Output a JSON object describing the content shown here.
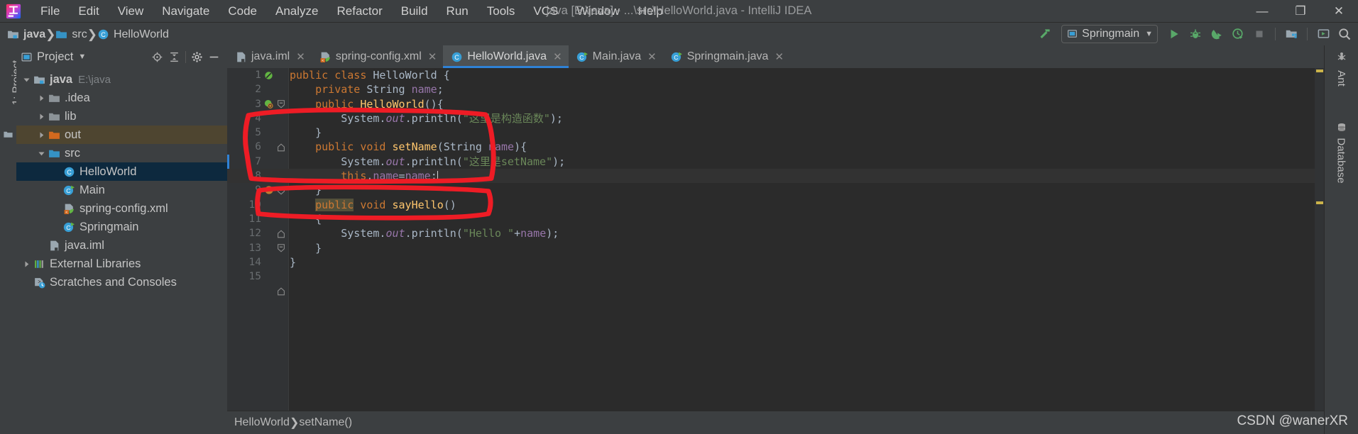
{
  "window": {
    "title": "java [E:\\java] - ...\\src\\HelloWorld.java - IntelliJ IDEA",
    "minimize": "—",
    "maximize": "❐",
    "close": "✕"
  },
  "menu": {
    "items": [
      {
        "label": "File",
        "mnemonic": "F"
      },
      {
        "label": "Edit",
        "mnemonic": "E"
      },
      {
        "label": "View",
        "mnemonic": "V"
      },
      {
        "label": "Navigate",
        "mnemonic": "N"
      },
      {
        "label": "Code",
        "mnemonic": "C"
      },
      {
        "label": "Analyze",
        "mnemonic": "z"
      },
      {
        "label": "Refactor",
        "mnemonic": "R"
      },
      {
        "label": "Build",
        "mnemonic": "B"
      },
      {
        "label": "Run",
        "mnemonic": "u"
      },
      {
        "label": "Tools",
        "mnemonic": "T"
      },
      {
        "label": "VCS",
        "mnemonic": "S"
      },
      {
        "label": "Window",
        "mnemonic": "W"
      },
      {
        "label": "Help",
        "mnemonic": "H"
      }
    ]
  },
  "navbar": {
    "crumbs": [
      {
        "label": "java",
        "icon": "module-folder-icon"
      },
      {
        "label": "src",
        "icon": "source-folder-icon"
      },
      {
        "label": "HelloWorld",
        "icon": "java-class-icon"
      }
    ],
    "separator": "❯"
  },
  "toolbar": {
    "build_label": "build-hammer-icon",
    "run_config": "Springmain",
    "run_config_caret": "▼",
    "buttons": [
      {
        "name": "run-button",
        "glyph": "▶"
      },
      {
        "name": "debug-button",
        "glyph": "debug-bug-icon"
      },
      {
        "name": "run-with-coverage-button",
        "glyph": "coverage-icon"
      },
      {
        "name": "profiler-button",
        "glyph": "profiler-icon"
      },
      {
        "name": "stop-button",
        "glyph": "■"
      },
      {
        "name": "project-structure-button",
        "glyph": "project-structure-icon"
      },
      {
        "name": "select-opened-file-button",
        "glyph": "terminal-icon"
      },
      {
        "name": "search-everywhere-button",
        "glyph": "search-icon"
      }
    ]
  },
  "left_strip": {
    "project_tool_label": "1: Project",
    "favorites_icon": "folder-icon"
  },
  "project_panel": {
    "title": "Project",
    "title_caret": "▼",
    "actions": [
      {
        "name": "scroll-from-source-icon"
      },
      {
        "name": "collapse-all-icon"
      },
      {
        "name": "settings-gear-icon"
      },
      {
        "name": "hide-panel-icon"
      }
    ],
    "tree": [
      {
        "label": "java",
        "suffix": "E:\\java",
        "depth": 0,
        "arrow": "down",
        "icon": "module-folder-icon",
        "bold": true,
        "state": "none"
      },
      {
        "label": ".idea",
        "suffix": "",
        "depth": 1,
        "arrow": "right",
        "icon": "folder-grey-icon",
        "bold": false,
        "state": "none"
      },
      {
        "label": "lib",
        "suffix": "",
        "depth": 1,
        "arrow": "right",
        "icon": "folder-grey-icon",
        "bold": false,
        "state": "none"
      },
      {
        "label": "out",
        "suffix": "",
        "depth": 1,
        "arrow": "right",
        "icon": "folder-orange-icon",
        "bold": false,
        "state": "brown"
      },
      {
        "label": "src",
        "suffix": "",
        "depth": 1,
        "arrow": "down",
        "icon": "source-folder-icon",
        "bold": false,
        "state": "none"
      },
      {
        "label": "HelloWorld",
        "suffix": "",
        "depth": 2,
        "arrow": "none",
        "icon": "java-class-icon",
        "bold": false,
        "state": "blue"
      },
      {
        "label": "Main",
        "suffix": "",
        "depth": 2,
        "arrow": "none",
        "icon": "java-runnable-class-icon",
        "bold": false,
        "state": "none"
      },
      {
        "label": "spring-config.xml",
        "suffix": "",
        "depth": 2,
        "arrow": "none",
        "icon": "spring-xml-icon",
        "bold": false,
        "state": "none"
      },
      {
        "label": "Springmain",
        "suffix": "",
        "depth": 2,
        "arrow": "none",
        "icon": "java-runnable-class-icon",
        "bold": false,
        "state": "none"
      },
      {
        "label": "java.iml",
        "suffix": "",
        "depth": 1,
        "arrow": "none",
        "icon": "iml-file-icon",
        "bold": false,
        "state": "none"
      },
      {
        "label": "External Libraries",
        "suffix": "",
        "depth": 0,
        "arrow": "right",
        "icon": "libraries-icon",
        "bold": false,
        "state": "none"
      },
      {
        "label": "Scratches and Consoles",
        "suffix": "",
        "depth": 0,
        "arrow": "none",
        "icon": "scratches-icon",
        "bold": false,
        "state": "none"
      }
    ]
  },
  "editor": {
    "tabs": [
      {
        "label": "java.iml",
        "icon": "iml-file-icon",
        "active": false,
        "close": "✕"
      },
      {
        "label": "spring-config.xml",
        "icon": "spring-xml-icon",
        "active": false,
        "close": "✕"
      },
      {
        "label": "HelloWorld.java",
        "icon": "java-class-icon",
        "active": true,
        "close": "✕"
      },
      {
        "label": "Main.java",
        "icon": "java-runnable-class-icon",
        "active": false,
        "close": "✕"
      },
      {
        "label": "Springmain.java",
        "icon": "java-runnable-class-icon",
        "active": false,
        "close": "✕"
      }
    ],
    "lines": [
      {
        "num": "1",
        "text": "public class HelloWorld {"
      },
      {
        "num": "2",
        "text": "    private String name;"
      },
      {
        "num": "3",
        "text": "    public HelloWorld(){"
      },
      {
        "num": "4",
        "text": "        System.out.println(\"这里是构造函数\");"
      },
      {
        "num": "5",
        "text": "    }"
      },
      {
        "num": "6",
        "text": "    public void setName(String name){"
      },
      {
        "num": "7",
        "text": "        System.out.println(\"这里是setName\");"
      },
      {
        "num": "8",
        "text": "        this.name=name;"
      },
      {
        "num": "9",
        "text": "    }"
      },
      {
        "num": "10",
        "text": "    public void sayHello()"
      },
      {
        "num": "11",
        "text": "    {"
      },
      {
        "num": "12",
        "text": "        System.out.println(\"Hello \"+name);"
      },
      {
        "num": "13",
        "text": "    }"
      },
      {
        "num": "14",
        "text": "}"
      },
      {
        "num": "15",
        "text": ""
      }
    ],
    "breadcrumb": {
      "class": "HelloWorld",
      "member": "setName()",
      "separator": "❯"
    }
  },
  "right_strip": {
    "items": [
      {
        "label": "Ant",
        "icon": "ant-icon"
      },
      {
        "label": "Database",
        "icon": "database-icon"
      }
    ]
  },
  "colors": {
    "accent_blue": "#2f82d6",
    "annotation_red": "#ee1c25",
    "keyword_orange": "#cc7832",
    "string_green": "#6a8759",
    "field_purple": "#9876aa",
    "method_yellow": "#ffc66d",
    "selection_blue": "#0d293e",
    "selection_brown": "#4e4530"
  },
  "watermark": "CSDN @wanerXR"
}
